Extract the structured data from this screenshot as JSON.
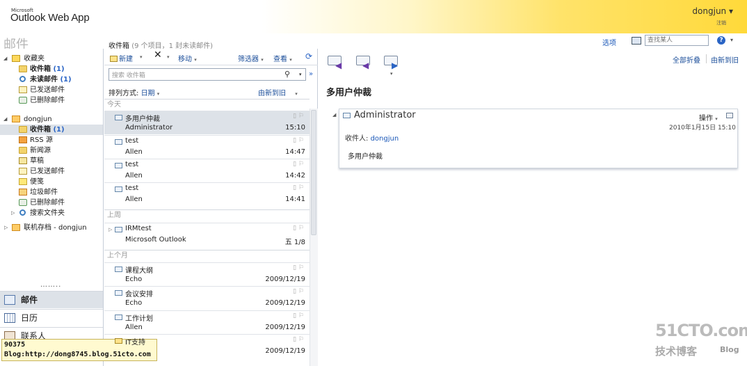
{
  "header": {
    "logo_small": "Microsoft",
    "logo_big": "Outlook Web App",
    "user": "dongjun ▾",
    "signout": "注销"
  },
  "topbar": {
    "section_title": "邮件",
    "inbox_title": "收件箱",
    "inbox_sub": "(9 个项目，1 封未读邮件)",
    "options": "选项",
    "find_placeholder": "查找某人",
    "help": "?",
    "help_caret": "▾"
  },
  "nav": {
    "favorites": [
      {
        "label": "收藏夹",
        "bold": false
      },
      {
        "label": "收件箱",
        "count": "(1)",
        "bold": true
      },
      {
        "label": "未读邮件",
        "count": "(1)",
        "bold": true
      },
      {
        "label": "已发送邮件",
        "bold": false
      },
      {
        "label": "已删除邮件",
        "bold": false
      }
    ],
    "mailbox": "dongjun",
    "folders": [
      {
        "label": "收件箱",
        "count": "(1)",
        "bold": true
      },
      {
        "label": "RSS 源"
      },
      {
        "label": "新闻源"
      },
      {
        "label": "草稿"
      },
      {
        "label": "已发送邮件"
      },
      {
        "label": "便笺"
      },
      {
        "label": "垃圾邮件"
      },
      {
        "label": "已删除邮件"
      },
      {
        "label": "搜索文件夹"
      }
    ],
    "archive": "联机存档 - dongjun",
    "dots": "……..",
    "buttons": [
      "邮件",
      "日历",
      "联系人"
    ]
  },
  "watermark": {
    "line1": "90375",
    "line2": "Blog:http://dong8745.blog.51cto.com"
  },
  "toolbar": {
    "new": "新建",
    "delete": "✕",
    "move": "移动",
    "filter": "筛选器",
    "view": "查看",
    "refresh": "⟳",
    "caret": "▾"
  },
  "list": {
    "search_placeholder": "搜索 收件箱",
    "search_mag": "⚲",
    "expand": "»",
    "sort_label": "排列方式:",
    "sort_value": "日期",
    "sort_order": "由新到旧",
    "groups": [
      "今天",
      "上周",
      "上个月"
    ],
    "messages": [
      {
        "subject": "多用户仲裁",
        "from": "Administrator",
        "time": "15:10"
      },
      {
        "subject": "test",
        "from": "Allen",
        "time": "14:47"
      },
      {
        "subject": "test",
        "from": "Allen",
        "time": "14:42"
      },
      {
        "subject": "test",
        "from": "Allen",
        "time": "14:41"
      },
      {
        "subject": "IRMtest",
        "from": "Microsoft Outlook",
        "time": "五 1/8"
      },
      {
        "subject": "课程大纲",
        "from": "Echo",
        "time": "2009/12/19"
      },
      {
        "subject": "会议安排",
        "from": "Echo",
        "time": "2009/12/19"
      },
      {
        "subject": "工作计划",
        "from": "Allen",
        "time": "2009/12/19"
      },
      {
        "subject": "IT支持",
        "from": "",
        "time": "2009/12/19"
      }
    ],
    "flags": "▯ ⚐"
  },
  "reading": {
    "collapse_all": "全部折叠",
    "newest_first": "由新到旧",
    "subject": "多用户仲裁",
    "from": "Administrator",
    "action": "操作",
    "date": "2010年1月15日  15:10",
    "to_label": "收件人:",
    "to": "dongjun",
    "body": "多用户仲裁"
  },
  "brand": {
    "big": "51CTO.com",
    "small": "技术博客",
    "blog": "Blog"
  }
}
